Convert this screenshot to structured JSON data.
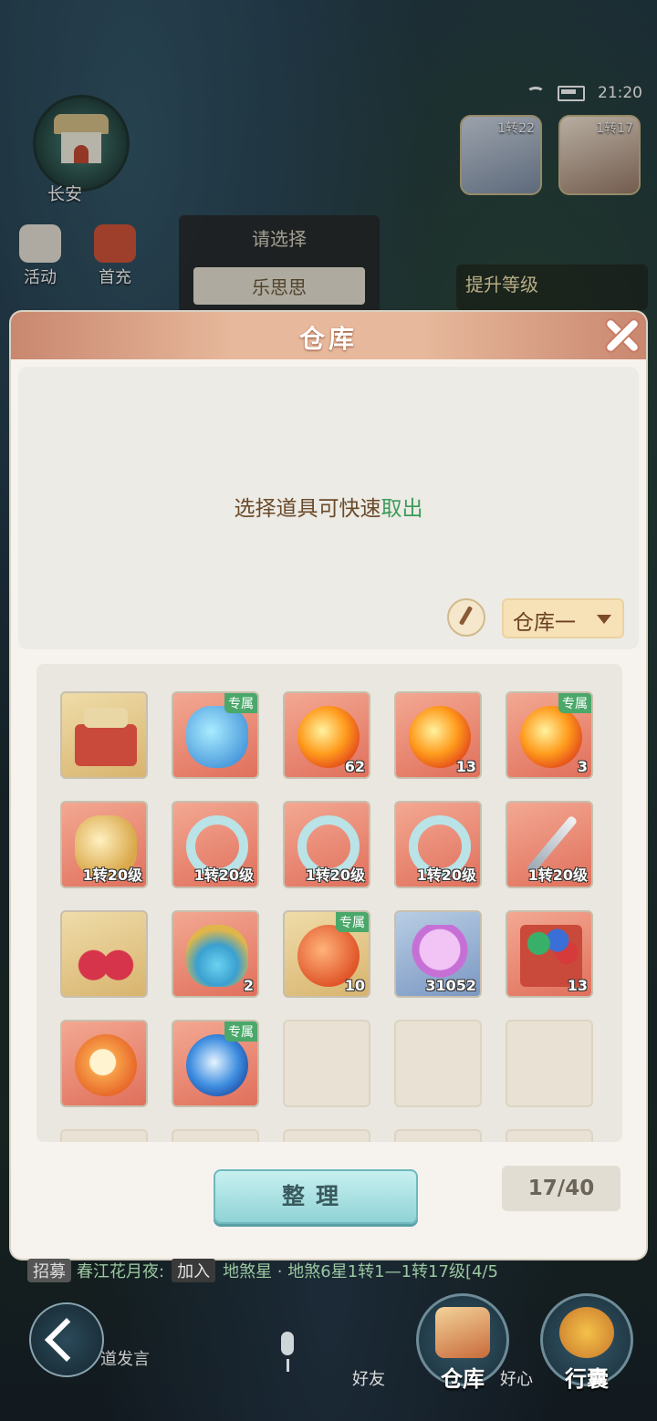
{
  "status": {
    "time": "21:20"
  },
  "city": {
    "name": "长安"
  },
  "top_menu": [
    {
      "label": "活动"
    },
    {
      "label": "首充"
    }
  ],
  "portraits": [
    {
      "level": "1转22"
    },
    {
      "level": "1转17"
    }
  ],
  "background_popup": {
    "title": "请选择",
    "option": "乐思思"
  },
  "quest": {
    "label": "提升等级"
  },
  "panel": {
    "title": "仓库",
    "hint_prefix": "选择道具可快速",
    "hint_accent": "取出",
    "warehouse_select": "仓库一",
    "sort_label": "整理",
    "capacity": "17/40"
  },
  "items": [
    {
      "name": "scroll-chest",
      "bg": "gold",
      "count": "",
      "tag": ""
    },
    {
      "name": "spirit-vase",
      "bg": "red",
      "count": "",
      "tag": "专属"
    },
    {
      "name": "fire-orb",
      "bg": "red",
      "count": "62",
      "tag": ""
    },
    {
      "name": "fire-orb",
      "bg": "red",
      "count": "13",
      "tag": ""
    },
    {
      "name": "fire-orb",
      "bg": "red",
      "count": "3",
      "tag": "专属"
    },
    {
      "name": "pet-figure",
      "bg": "red",
      "count": "1转20级",
      "tag": ""
    },
    {
      "name": "jade-ring",
      "bg": "red",
      "count": "1转20级",
      "tag": ""
    },
    {
      "name": "jade-ring",
      "bg": "red",
      "count": "1转20级",
      "tag": ""
    },
    {
      "name": "jade-ring",
      "bg": "red",
      "count": "1转20级",
      "tag": ""
    },
    {
      "name": "sword",
      "bg": "red",
      "count": "1转20级",
      "tag": ""
    },
    {
      "name": "cherry",
      "bg": "gold",
      "count": "",
      "tag": ""
    },
    {
      "name": "potion",
      "bg": "red",
      "count": "2",
      "tag": ""
    },
    {
      "name": "fruit",
      "bg": "gold",
      "count": "10",
      "tag": "专属"
    },
    {
      "name": "flower",
      "bg": "blue",
      "count": "31052",
      "tag": ""
    },
    {
      "name": "gem-chest",
      "bg": "red",
      "count": "13",
      "tag": ""
    },
    {
      "name": "paw-orb",
      "bg": "red",
      "count": "",
      "tag": ""
    },
    {
      "name": "swirl-orb",
      "bg": "red",
      "count": "",
      "tag": "专属"
    }
  ],
  "chat": {
    "tag": "招募",
    "sender": "春江花月夜:",
    "join": "加入",
    "message": "地煞星 · 地煞6星1转1—1转17级[4/5",
    "input_hint": "道发言"
  },
  "bottom_bar": {
    "friends": "好友",
    "heart": "好心",
    "warehouse": "仓库",
    "bag": "行囊"
  }
}
